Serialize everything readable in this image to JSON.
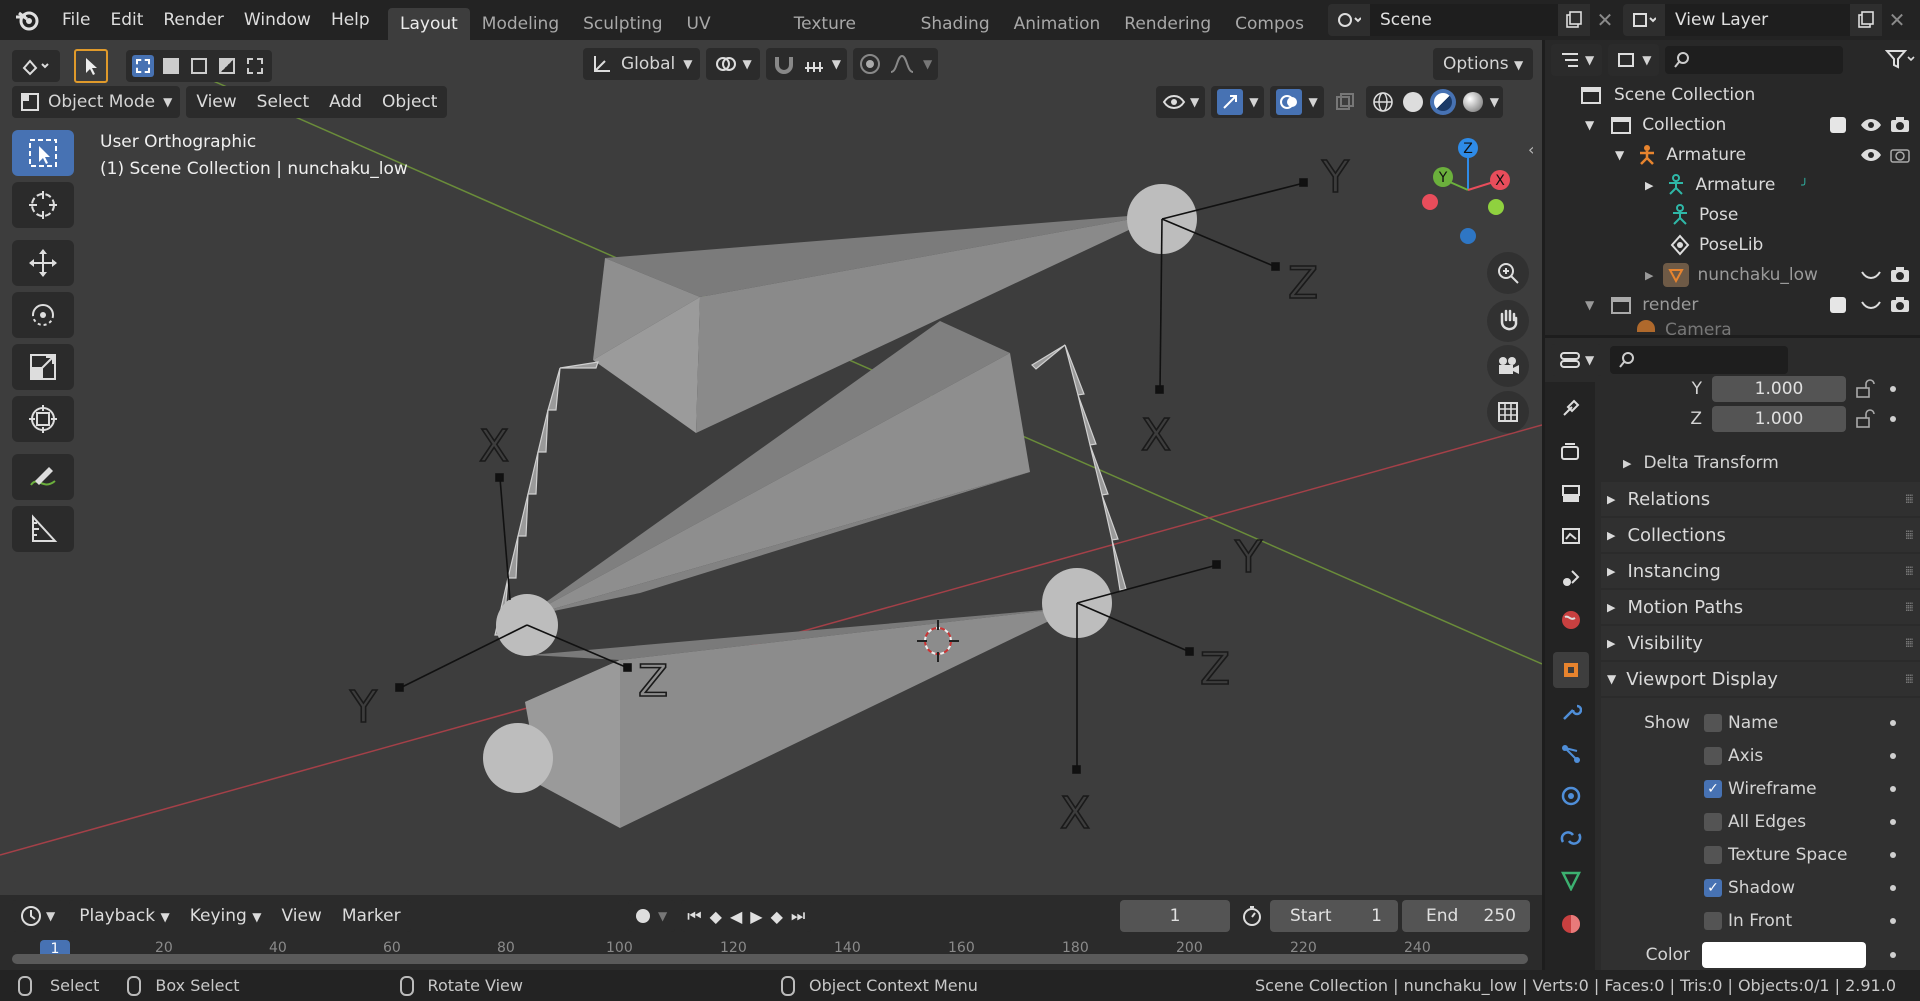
{
  "menu": [
    "File",
    "Edit",
    "Render",
    "Window",
    "Help"
  ],
  "workspaces": [
    "Layout",
    "Modeling",
    "Sculpting",
    "UV Editing",
    "Texture Paint",
    "Shading",
    "Animation",
    "Rendering",
    "Compos"
  ],
  "active_workspace": "Layout",
  "scene_name": "Scene",
  "view_layer": "View Layer",
  "toolbar": {
    "orientation": "Global",
    "options": "Options"
  },
  "viewport_header": {
    "mode": "Object Mode",
    "menus": [
      "View",
      "Select",
      "Add",
      "Object"
    ]
  },
  "viewport_overlay": {
    "view_name": "User Orthographic",
    "context": "(1) Scene Collection | nunchaku_low"
  },
  "axis_letters": [
    "Y",
    "Z",
    "X",
    "X",
    "Y",
    "Z",
    "Y",
    "Z",
    "X",
    "Y"
  ],
  "gizmo_axes": [
    "Z",
    "Y",
    "X"
  ],
  "timeline": {
    "menus": [
      "Playback",
      "Keying",
      "View",
      "Marker"
    ],
    "current_frame": "1",
    "start_label": "Start",
    "start": "1",
    "end_label": "End",
    "end": "250",
    "ruler": [
      "1",
      "20",
      "40",
      "60",
      "80",
      "100",
      "120",
      "140",
      "160",
      "180",
      "200",
      "220",
      "240"
    ]
  },
  "status": {
    "select": "Select",
    "box_select": "Box Select",
    "rotate": "Rotate View",
    "context_menu": "Object Context Menu",
    "info": "Scene Collection | nunchaku_low | Verts:0 | Faces:0 | Tris:0 | Objects:0/1 | 2.91.0"
  },
  "outliner": [
    {
      "label": "Scene Collection",
      "indent": 0,
      "icon": "collection-icon"
    },
    {
      "label": "Collection",
      "indent": 1,
      "icon": "collection-icon"
    },
    {
      "label": "Armature",
      "indent": 2,
      "icon": "armature-icon"
    },
    {
      "label": "Armature",
      "indent": 3,
      "icon": "armature-data-icon"
    },
    {
      "label": "Pose",
      "indent": 3,
      "icon": "pose-icon"
    },
    {
      "label": "PoseLib",
      "indent": 3,
      "icon": "poselib-icon"
    },
    {
      "label": "nunchaku_low",
      "indent": 3,
      "icon": "mesh-object-icon"
    },
    {
      "label": "render",
      "indent": 1,
      "icon": "collection-icon"
    },
    {
      "label": "Camera",
      "indent": 2,
      "icon": "camera-icon"
    }
  ],
  "properties": {
    "y_label": "Y",
    "y_value": "1.000",
    "z_label": "Z",
    "z_value": "1.000",
    "delta_transform": "Delta Transform",
    "panels": [
      "Relations",
      "Collections",
      "Instancing",
      "Motion Paths",
      "Visibility",
      "Viewport Display"
    ],
    "show_label": "Show",
    "show_options": [
      {
        "label": "Name",
        "checked": false
      },
      {
        "label": "Axis",
        "checked": false
      },
      {
        "label": "Wireframe",
        "checked": true
      },
      {
        "label": "All Edges",
        "checked": false
      },
      {
        "label": "Texture Space",
        "checked": false
      },
      {
        "label": "Shadow",
        "checked": true
      },
      {
        "label": "In Front",
        "checked": false
      }
    ],
    "color_label": "Color"
  },
  "colors": {
    "accent": "#4772b3",
    "x_axis": "#e84d5b",
    "y_axis": "#6bb03c",
    "z_axis": "#2e8be8",
    "viewport_bg": "#3d3d3d"
  }
}
